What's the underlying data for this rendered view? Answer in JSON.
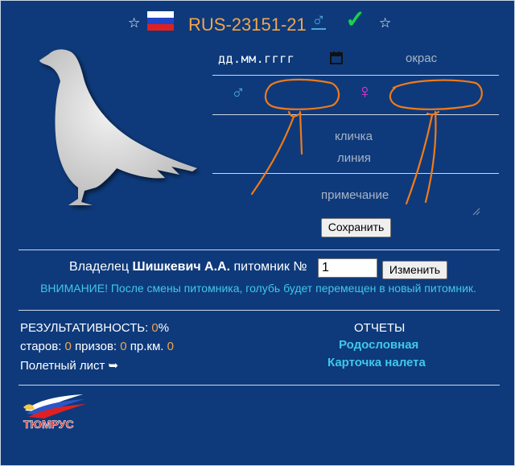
{
  "header": {
    "ring_number": "RUS-23151-21",
    "star_icon": "☆",
    "male_symbol": "♂",
    "check_symbol": "✓",
    "flag_colors": [
      "#ffffff",
      "#1f45c9",
      "#e02020"
    ]
  },
  "form": {
    "date_placeholder": "дд.мм.гггг",
    "color_placeholder": "окрас",
    "male_symbol": "♂",
    "female_symbol": "♀",
    "name_placeholder": "кличка",
    "line_placeholder": "линия",
    "note_placeholder": "примечание",
    "save_label": "Сохранить"
  },
  "owner": {
    "label": "Владелец",
    "name": "Шишкевич А.А.",
    "kennel_label": "питомник №",
    "kennel_value": "1",
    "change_label": "Изменить",
    "warning": "ВНИМАНИЕ! После смены питомника, голубь будет перемещен в новый питомник."
  },
  "stats": {
    "performance_label": "РЕЗУЛЬТАТИВНОСТЬ:",
    "performance_value": "0",
    "performance_unit": "%",
    "starts_label": "старов:",
    "starts_value": "0",
    "prizes_label": "призов:",
    "prizes_value": "0",
    "prkm_label": "пр.км.",
    "prkm_value": "0",
    "flight_sheet_label": "Полетный лист",
    "flight_sheet_arrow": "➥"
  },
  "reports": {
    "title": "ОТЧЕТЫ",
    "pedigree_link": "Родословная",
    "flight_card_link": "Карточка налета"
  },
  "logo": {
    "text": "ТЮМРУС"
  },
  "colors": {
    "background": "#0e3a7b",
    "accent_orange": "#f2a54a",
    "link_cyan": "#40c8e8",
    "male_blue": "#4ba7d6",
    "female_pink": "#e23ad0",
    "annotation_orange": "#f07a1a"
  }
}
